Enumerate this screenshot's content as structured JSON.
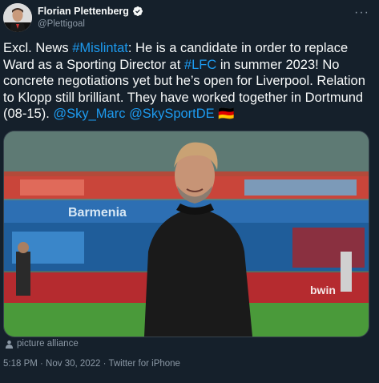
{
  "author": {
    "name": "Florian Plettenberg",
    "handle": "@Plettigoal",
    "verified": true
  },
  "tweet": {
    "segments": [
      {
        "text": "Excl. News ",
        "link": false
      },
      {
        "text": "#Mislintat",
        "link": true
      },
      {
        "text": ": He is a candidate in order to replace Ward as a Sporting Director at ",
        "link": false
      },
      {
        "text": "#LFC",
        "link": true
      },
      {
        "text": " in summer 2023! No concrete negotiations yet but he’s open for Liverpool. Relation to Klopp still brilliant. They have worked together in Dortmund (08-15). ",
        "link": false
      },
      {
        "text": "@Sky_Marc",
        "link": true
      },
      {
        "text": " ",
        "link": false
      },
      {
        "text": "@SkySportDE",
        "link": true
      },
      {
        "text": " 🇩🇪",
        "link": false
      }
    ]
  },
  "media": {
    "credit": "picture alliance",
    "stadium_banner_text": [
      "bwin",
      "Barmenia"
    ]
  },
  "meta": {
    "timestamp": "5:18 PM · Nov 30, 2022 · Twitter for iPhone"
  },
  "colors": {
    "background": "#15202b",
    "link": "#1d9bf0",
    "secondary_text": "#8b98a5"
  },
  "icons": [
    "avatar",
    "verified-badge-icon",
    "more-options-icon",
    "person-icon"
  ]
}
